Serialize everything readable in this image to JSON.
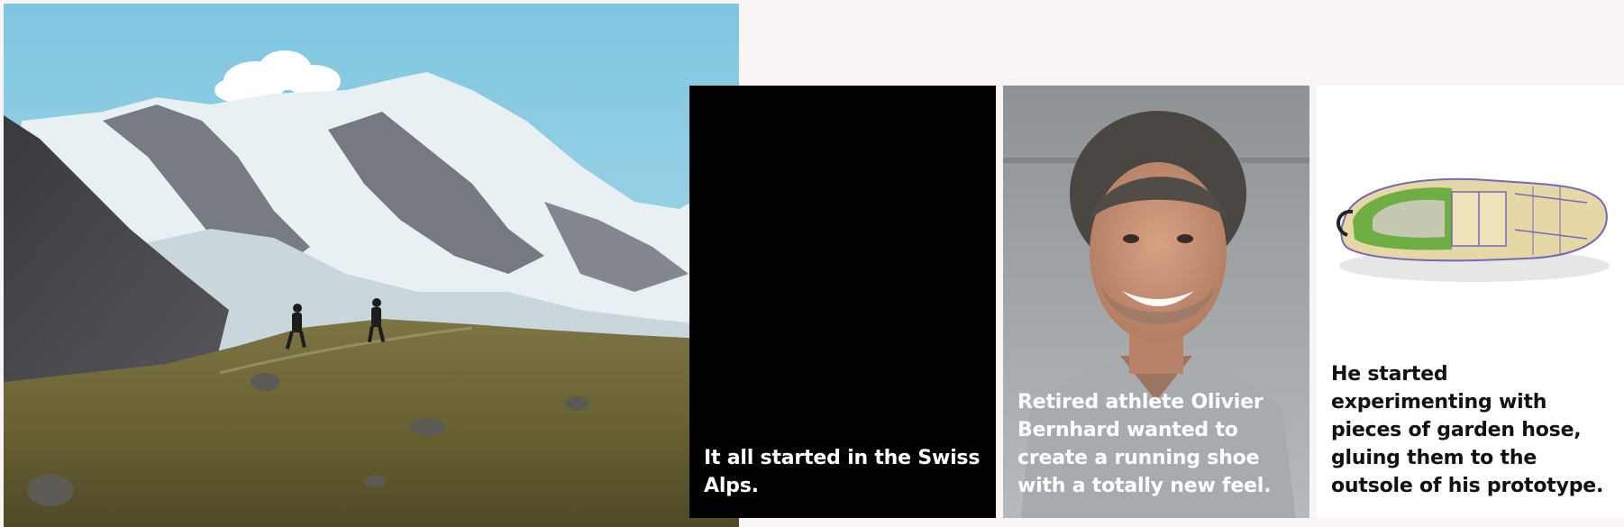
{
  "story": {
    "hero_image": {
      "icon": "alpine-landscape-photo"
    },
    "cards": [
      {
        "caption": "It all started in the Swiss Alps.",
        "background": "#000000",
        "text_color": "#ffffff"
      },
      {
        "caption": "Retired athlete Olivier Bernhard wanted to create a running shoe with a totally new feel.",
        "image": "portrait-photo",
        "text_color": "#ffffff"
      },
      {
        "caption": "He started experimenting with pieces of garden hose, gluing them to the outsole of his prototype.",
        "image": "prototype-shoe-photo",
        "background": "#ffffff",
        "text_color": "#111111"
      }
    ]
  },
  "colors": {
    "page_background": "#f8f5f4",
    "sky": "#8ccde4",
    "hillside": "#6f6a3a"
  }
}
